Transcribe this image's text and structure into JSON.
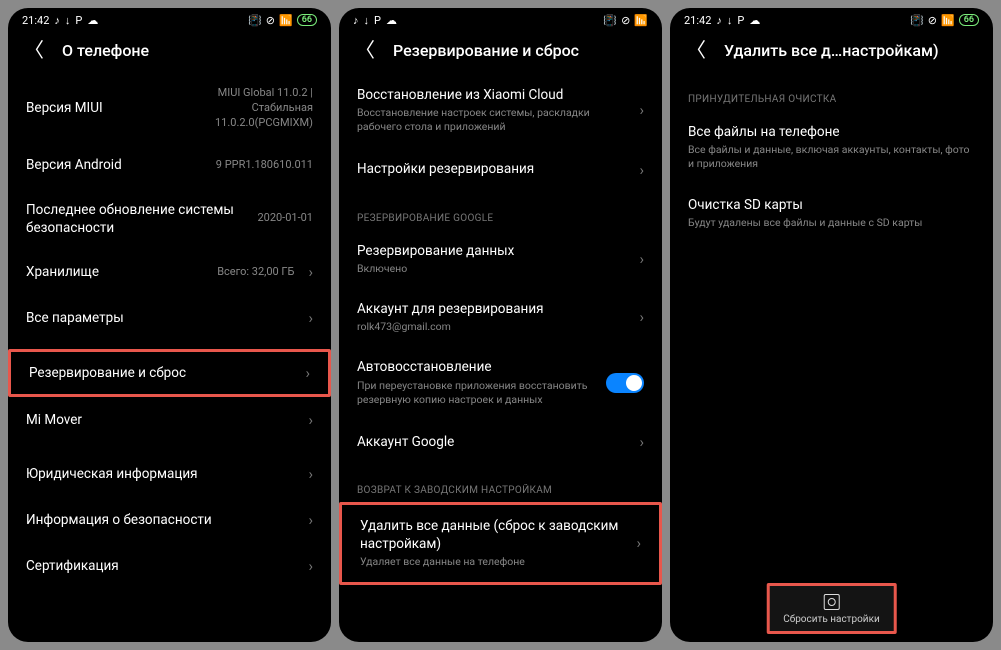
{
  "status": {
    "time": "21:42",
    "icons": [
      "♪",
      "↓",
      "P",
      "☁"
    ],
    "vibrate": "✳",
    "nosim": "⊘",
    "signal": "📶",
    "battery": "66"
  },
  "screen1": {
    "title": "О телефоне",
    "rows": {
      "miui": {
        "label": "Версия MIUI",
        "value": "MIUI Global 11.0.2 | Стабильная 11.0.2.0(PCGMIXM)"
      },
      "android": {
        "label": "Версия Android",
        "value": "9 PPR1.180610.011"
      },
      "security": {
        "label": "Последнее обновление системы безопасности",
        "value": "2020-01-01"
      },
      "storage": {
        "label": "Хранилище",
        "value": "Всего: 32,00 ГБ"
      },
      "allparams": {
        "label": "Все параметры"
      },
      "backup": {
        "label": "Резервирование и сброс"
      },
      "mimover": {
        "label": "Mi Mover"
      },
      "legal": {
        "label": "Юридическая информация"
      },
      "secinfo": {
        "label": "Информация о безопасности"
      },
      "cert": {
        "label": "Сертификация"
      }
    }
  },
  "screen2": {
    "title": "Резервирование и сброс",
    "rows": {
      "xiaomicloud": {
        "label": "Восстановление из Xiaomi Cloud",
        "sub": "Восстановление настроек системы, раскладки рабочего стола и приложений"
      },
      "backupsettings": {
        "label": "Настройки резервирования"
      },
      "section_google": "РЕЗЕРВИРОВАНИЕ GOOGLE",
      "databackup": {
        "label": "Резервирование данных",
        "sub": "Включено"
      },
      "account": {
        "label": "Аккаунт для резервирования",
        "sub": "rolk473@gmail.com"
      },
      "autorestore": {
        "label": "Автовосстановление",
        "sub": "При переустановке приложения восстановить резервную копию настроек и данных"
      },
      "googleacc": {
        "label": "Аккаунт Google"
      },
      "section_factory": "ВОЗВРАТ К ЗАВОДСКИМ НАСТРОЙКАМ",
      "erase": {
        "label": "Удалить все данные (сброс к заводским настройкам)",
        "sub": "Удаляет все данные на телефоне"
      }
    }
  },
  "screen3": {
    "title": "Удалить все д…настройкам)",
    "section_force": "ПРИНУДИТЕЛЬНАЯ ОЧИСТКА",
    "rows": {
      "allfiles": {
        "label": "Все файлы на телефоне",
        "sub": "Все файлы и данные, включая аккаунты, контакты, фото и приложения"
      },
      "sdcard": {
        "label": "Очистка SD карты",
        "sub": "Будут удалены все файлы и данные с SD карты"
      }
    },
    "bottom": "Сбросить настройки"
  }
}
